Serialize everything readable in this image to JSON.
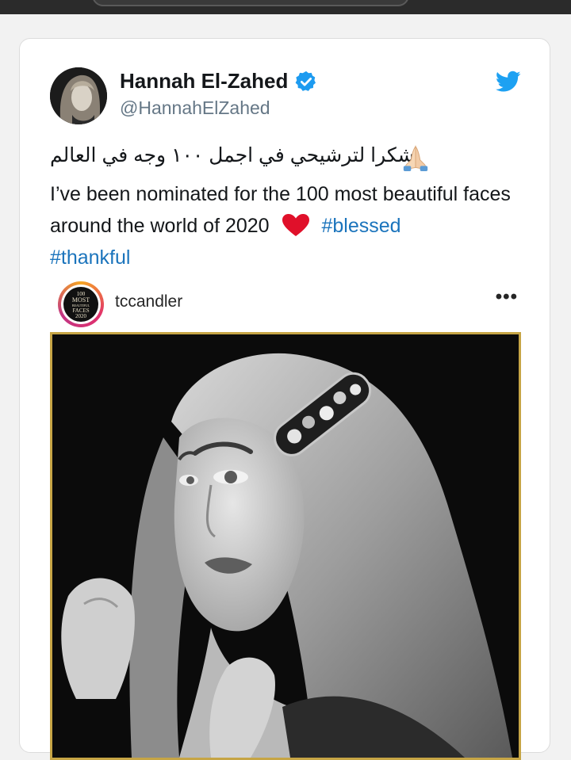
{
  "tweet": {
    "author_name": "Hannah El-Zahed",
    "author_handle": "@HannahElZahed",
    "arabic_text": ".شكرا لترشيحي في اجمل ١٠٠ وجه في العالم",
    "text_before": "I’ve been nominated for the 100 most beautiful faces around the world of 2020",
    "hashtag_1": "#blessed",
    "hashtag_2": "#thankful",
    "emoji_icons": [
      "folded-hands-icon",
      "red-heart-icon"
    ]
  },
  "embed": {
    "username": "tccandler",
    "more_label": "•••",
    "avatar_badge_lines": [
      "100",
      "MOST",
      "BEAUTIFUL",
      "FACES",
      "2020"
    ]
  },
  "colors": {
    "verified": "#1d9bf0",
    "twitter_blue": "#1da1f2",
    "hashtag": "#1b74bc",
    "heart": "#e0102a",
    "frame_gold": "#c6a545"
  }
}
